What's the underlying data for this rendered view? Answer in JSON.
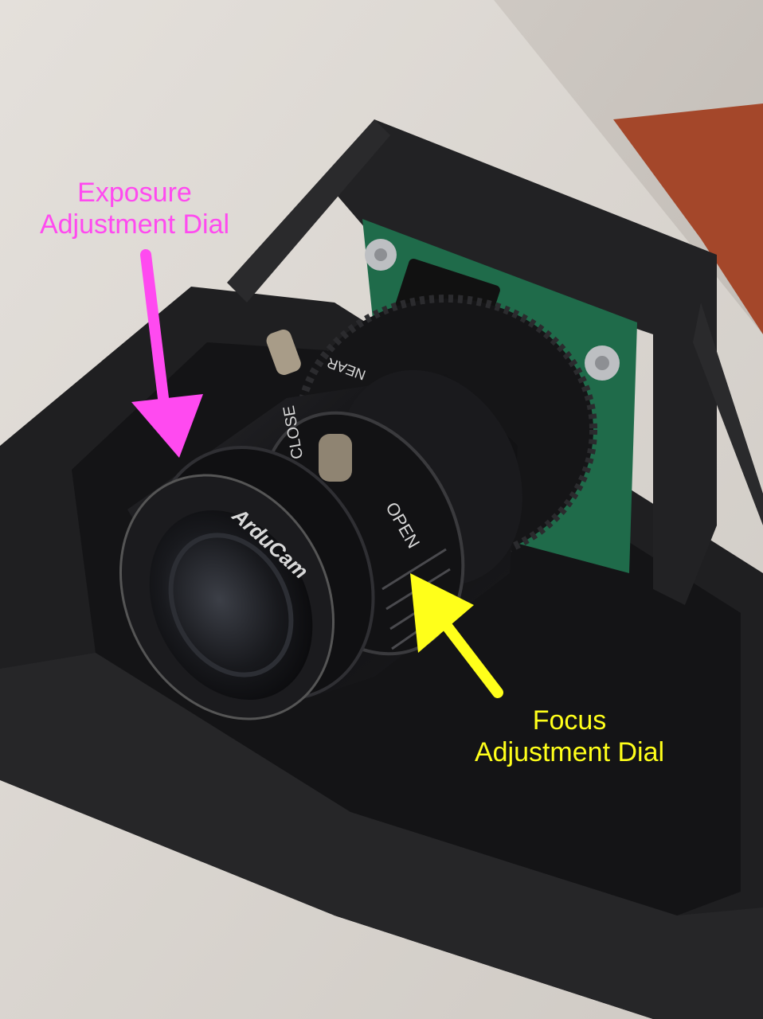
{
  "annotations": {
    "exposure": {
      "line1": "Exposure",
      "line2": "Adjustment Dial",
      "color": "#ff4af0"
    },
    "focus": {
      "line1": "Focus",
      "line2": "Adjustment Dial",
      "color": "#ffff1a"
    }
  },
  "lens_markings": {
    "brand": "ArduCam",
    "close": "CLOSE",
    "open": "OPEN",
    "near": "NEAR"
  },
  "colors": {
    "background_wall": "#c9c3bc",
    "floor": "#a4472a",
    "mount": "#1d1d1f",
    "lens": "#101012",
    "pcb": "#1f6b4a"
  }
}
